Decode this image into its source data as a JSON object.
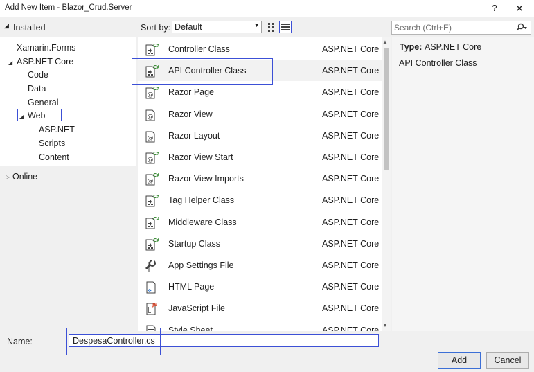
{
  "window": {
    "title": "Add New Item - Blazor_Crud.Server",
    "help": "?",
    "close": "✕"
  },
  "left": {
    "installed": "Installed",
    "tree": [
      {
        "label": "Xamarin.Forms"
      },
      {
        "label": "ASP.NET Core"
      },
      {
        "label": "Code"
      },
      {
        "label": "Data"
      },
      {
        "label": "General"
      },
      {
        "label": "Web"
      },
      {
        "label": "ASP.NET"
      },
      {
        "label": "Scripts"
      },
      {
        "label": "Content"
      }
    ],
    "online": "Online"
  },
  "toolbar": {
    "sort_label": "Sort by:",
    "sort_value": "Default"
  },
  "search": {
    "placeholder": "Search (Ctrl+E)"
  },
  "items": [
    {
      "name": "Controller Class",
      "category": "ASP.NET Core",
      "icon": "csharp-class-icon"
    },
    {
      "name": "API Controller Class",
      "category": "ASP.NET Core",
      "icon": "csharp-class-icon"
    },
    {
      "name": "Razor Page",
      "category": "ASP.NET Core",
      "icon": "razor-csharp-icon"
    },
    {
      "name": "Razor View",
      "category": "ASP.NET Core",
      "icon": "razor-icon"
    },
    {
      "name": "Razor Layout",
      "category": "ASP.NET Core",
      "icon": "razor-icon"
    },
    {
      "name": "Razor View Start",
      "category": "ASP.NET Core",
      "icon": "razor-csharp-icon"
    },
    {
      "name": "Razor View Imports",
      "category": "ASP.NET Core",
      "icon": "razor-csharp-icon"
    },
    {
      "name": "Tag Helper Class",
      "category": "ASP.NET Core",
      "icon": "csharp-class-icon"
    },
    {
      "name": "Middleware Class",
      "category": "ASP.NET Core",
      "icon": "csharp-class-icon"
    },
    {
      "name": "Startup Class",
      "category": "ASP.NET Core",
      "icon": "csharp-class-icon"
    },
    {
      "name": "App Settings File",
      "category": "ASP.NET Core",
      "icon": "settings-file-icon"
    },
    {
      "name": "HTML Page",
      "category": "ASP.NET Core",
      "icon": "html-file-icon"
    },
    {
      "name": "JavaScript File",
      "category": "ASP.NET Core",
      "icon": "javascript-file-icon"
    },
    {
      "name": "Style Sheet",
      "category": "ASP.NET Core",
      "icon": "stylesheet-icon"
    }
  ],
  "details": {
    "type_label": "Type:",
    "type_value": "ASP.NET Core",
    "description": "API Controller Class"
  },
  "bottom": {
    "name_label": "Name:",
    "name_value": "DespesaController.cs",
    "add": "Add",
    "cancel": "Cancel"
  },
  "colors": {
    "accent": "#3c50d6",
    "csharp": "#388a34"
  }
}
